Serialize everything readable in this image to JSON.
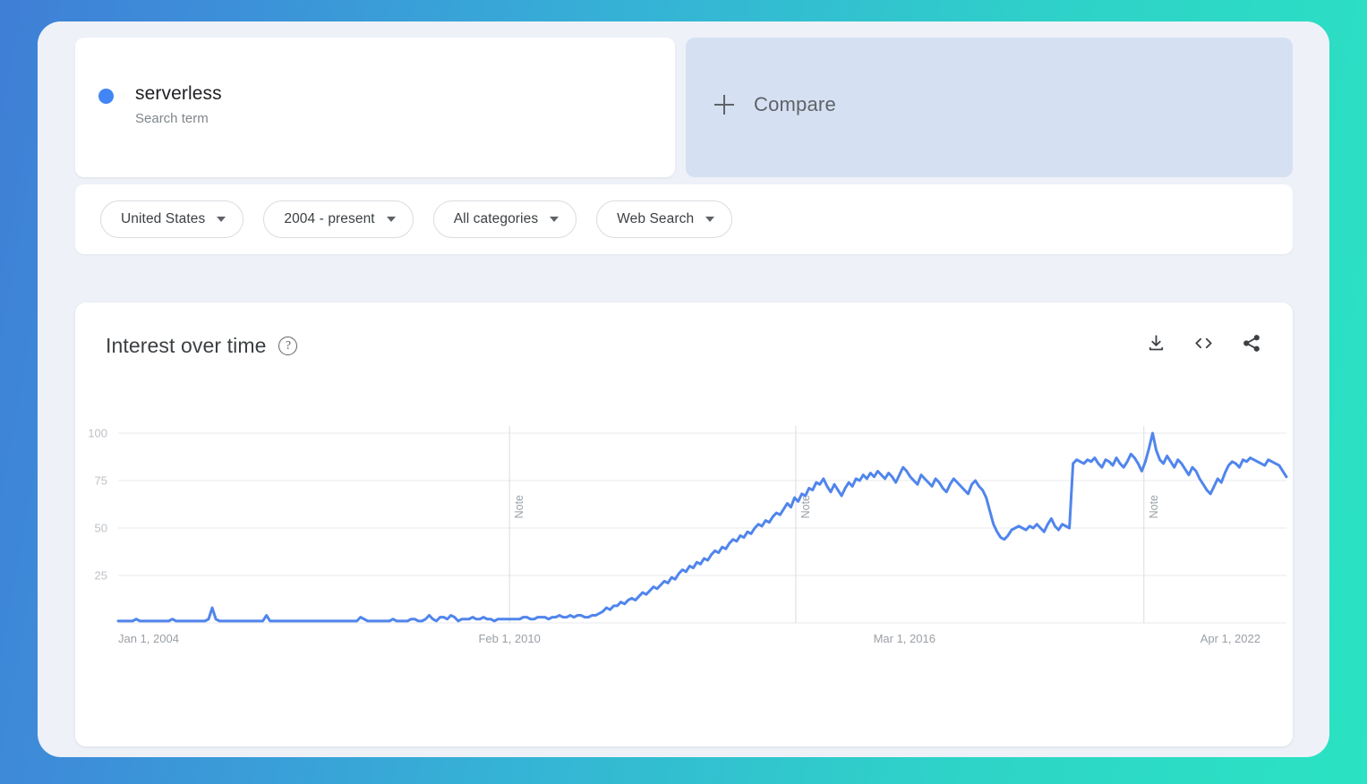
{
  "theme": {
    "accent": "#4285f4",
    "bg_gradient_from": "#3f7fd6",
    "bg_gradient_to": "#2ae3c2",
    "card_bg": "#ffffff",
    "shell_bg": "#eef1f8",
    "compare_bg": "#d5e1f2"
  },
  "search": {
    "term": "serverless",
    "type_label": "Search term",
    "dot_color": "#4285f4"
  },
  "compare": {
    "label": "Compare",
    "icon": "plus-icon"
  },
  "filters": [
    {
      "label": "United States",
      "icon": "chevron-down-icon"
    },
    {
      "label": "2004 - present",
      "icon": "chevron-down-icon"
    },
    {
      "label": "All categories",
      "icon": "chevron-down-icon"
    },
    {
      "label": "Web Search",
      "icon": "chevron-down-icon"
    }
  ],
  "chart_panel": {
    "title": "Interest over time",
    "help_icon": "help-circle-icon",
    "help_glyph": "?",
    "actions": [
      {
        "name": "download-icon",
        "tooltip": "Download"
      },
      {
        "name": "embed-code-icon",
        "tooltip": "Embed"
      },
      {
        "name": "share-icon",
        "tooltip": "Share"
      }
    ]
  },
  "chart_data": {
    "type": "line",
    "title": "Interest over time",
    "xlabel": "",
    "ylabel": "",
    "ylim": [
      0,
      100
    ],
    "yticks": [
      25,
      50,
      75,
      100
    ],
    "ytick_labels": [
      "25",
      "50",
      "75",
      "100"
    ],
    "grid": true,
    "legend": false,
    "series_color": "#5085ec",
    "line_width": 3,
    "x_tick_labels": [
      "Jan 1, 2004",
      "Feb 1, 2010",
      "Mar 1, 2016",
      "Apr 1, 2022"
    ],
    "x_tick_positions": [
      0,
      0.335,
      0.673,
      0.952
    ],
    "annotations": [
      {
        "label": "Note",
        "position": 0.335
      },
      {
        "label": "Note",
        "position": 0.58
      },
      {
        "label": "Note",
        "position": 0.878
      }
    ],
    "series": [
      {
        "name": "serverless",
        "values": [
          1,
          1,
          1,
          1,
          1,
          2,
          1,
          1,
          1,
          1,
          1,
          1,
          1,
          1,
          1,
          2,
          1,
          1,
          1,
          1,
          1,
          1,
          1,
          1,
          1,
          2,
          8,
          2,
          1,
          1,
          1,
          1,
          1,
          1,
          1,
          1,
          1,
          1,
          1,
          1,
          1,
          4,
          1,
          1,
          1,
          1,
          1,
          1,
          1,
          1,
          1,
          1,
          1,
          1,
          1,
          1,
          1,
          1,
          1,
          1,
          1,
          1,
          1,
          1,
          1,
          1,
          1,
          3,
          2,
          1,
          1,
          1,
          1,
          1,
          1,
          1,
          2,
          1,
          1,
          1,
          1,
          2,
          2,
          1,
          1,
          2,
          4,
          2,
          1,
          3,
          3,
          2,
          4,
          3,
          1,
          2,
          2,
          2,
          3,
          2,
          2,
          3,
          2,
          2,
          1,
          2,
          2,
          2,
          2,
          2,
          2,
          2,
          3,
          3,
          2,
          2,
          3,
          3,
          3,
          2,
          3,
          3,
          4,
          3,
          3,
          4,
          3,
          4,
          4,
          3,
          3,
          4,
          4,
          5,
          6,
          8,
          7,
          9,
          9,
          11,
          10,
          12,
          13,
          12,
          14,
          16,
          15,
          17,
          19,
          18,
          20,
          22,
          21,
          24,
          23,
          26,
          28,
          27,
          30,
          29,
          32,
          31,
          34,
          33,
          36,
          38,
          37,
          40,
          39,
          42,
          44,
          43,
          46,
          45,
          48,
          47,
          50,
          52,
          51,
          54,
          53,
          56,
          58,
          57,
          60,
          63,
          61,
          66,
          64,
          68,
          67,
          71,
          70,
          74,
          73,
          76,
          72,
          69,
          73,
          70,
          67,
          71,
          74,
          72,
          76,
          75,
          78,
          76,
          79,
          77,
          80,
          78,
          76,
          79,
          77,
          74,
          78,
          82,
          80,
          77,
          75,
          73,
          78,
          76,
          74,
          72,
          76,
          74,
          71,
          69,
          73,
          76,
          74,
          72,
          70,
          68,
          73,
          75,
          72,
          70,
          66,
          59,
          52,
          48,
          45,
          44,
          46,
          49,
          50,
          51,
          50,
          49,
          51,
          50,
          52,
          50,
          48,
          52,
          55,
          51,
          49,
          52,
          51,
          50,
          84,
          86,
          85,
          84,
          86,
          85,
          87,
          84,
          82,
          86,
          85,
          83,
          87,
          84,
          82,
          85,
          89,
          87,
          84,
          80,
          85,
          92,
          100,
          91,
          86,
          84,
          88,
          85,
          82,
          86,
          84,
          81,
          78,
          82,
          80,
          76,
          73,
          70,
          68,
          72,
          76,
          74,
          79,
          83,
          85,
          84,
          82,
          86,
          85,
          87,
          86,
          85,
          84,
          83,
          86,
          85,
          84,
          83,
          80,
          77
        ]
      }
    ]
  }
}
